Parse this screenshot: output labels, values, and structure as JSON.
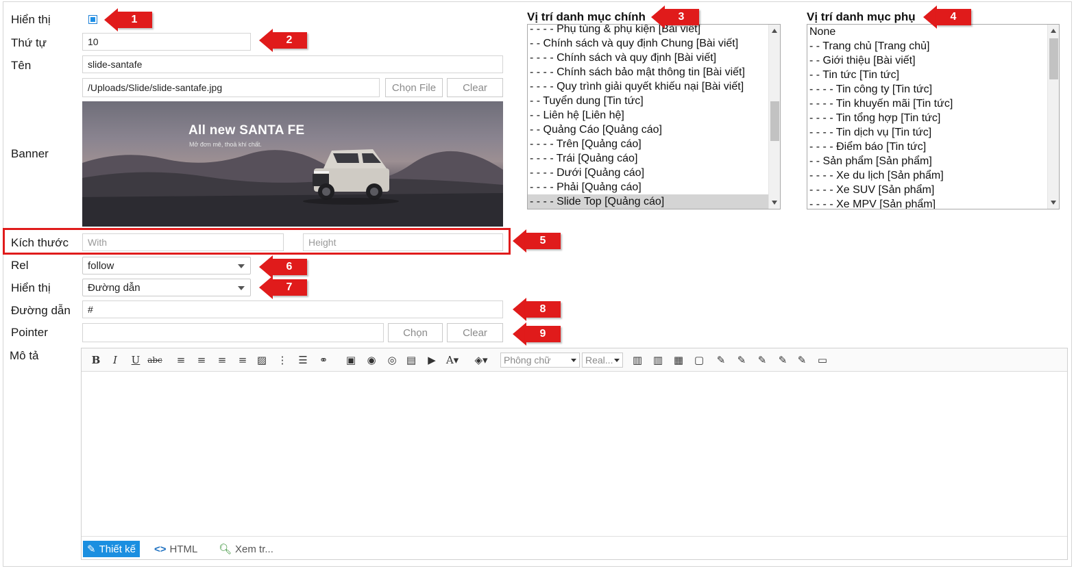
{
  "form": {
    "hien_thi_label": "Hiển thị",
    "thu_tu_label": "Thứ tự",
    "thu_tu_value": "10",
    "ten_label": "Tên",
    "ten_value": "slide-santafe",
    "file_path": "/Uploads/Slide/slide-santafe.jpg",
    "choose_file_label": "Chọn File",
    "clear_label": "Clear",
    "banner_label": "Banner",
    "banner_title": "All new SANTA FE",
    "banner_subtitle": "Mở đơn mê, thoả khí chất.",
    "kich_thuoc_label": "Kích thước",
    "width_placeholder": "With",
    "height_placeholder": "Height",
    "rel_label": "Rel",
    "rel_value": "follow",
    "hien_thi2_label": "Hiển thị",
    "hien_thi2_value": "Đường dẫn",
    "duong_dan_label": "Đường dẫn",
    "duong_dan_value": "#",
    "pointer_label": "Pointer",
    "pointer_choose_label": "Chọn",
    "pointer_clear_label": "Clear",
    "mo_ta_label": "Mô tả"
  },
  "badges": [
    "1",
    "2",
    "3",
    "4",
    "5",
    "6",
    "7",
    "8",
    "9"
  ],
  "main_category": {
    "title": "Vị trí danh mục chính",
    "items": [
      "- - - - Phụ tùng & phụ kiện [Bài viết]",
      "- - Chính sách và quy định Chung [Bài viết]",
      "- - - - Chính sách và quy định [Bài viết]",
      "- - - - Chính sách bảo mật thông tin [Bài viết]",
      "- - - - Quy trình giải quyết khiếu nại [Bài viết]",
      "- - Tuyển dung [Tin tức]",
      "- - Liên hệ [Liên hệ]",
      "- - Quảng Cáo [Quảng cáo]",
      "- - - - Trên [Quảng cáo]",
      "- - - - Trái [Quảng cáo]",
      "- - - - Dưới [Quảng cáo]",
      "- - - - Phải [Quảng cáo]",
      "- - - - Slide Top [Quảng cáo]"
    ],
    "selected_index": 12
  },
  "sub_category": {
    "title": "Vị trí danh mục phụ",
    "items": [
      "None",
      "- - Trang chủ [Trang chủ]",
      "- - Giới thiệu [Bài viết]",
      "- - Tin tức [Tin tức]",
      "- - - - Tin công ty [Tin tức]",
      "- - - - Tin khuyến mãi [Tin tức]",
      "- - - - Tin tổng hợp [Tin tức]",
      "- - - - Tin dịch vụ [Tin tức]",
      "- - - - Điểm báo [Tin tức]",
      "- - Sản phẩm [Sản phẩm]",
      "- - - - Xe du lịch [Sản phẩm]",
      "- - - - Xe SUV [Sản phẩm]",
      "- - - - Xe MPV [Sản phẩm]"
    ]
  },
  "editor": {
    "font_placeholder": "Phông chữ",
    "size_placeholder": "Real...",
    "mode_design": "Thiết kế",
    "mode_html": "HTML",
    "mode_preview": "Xem tr..."
  },
  "colors": {
    "accent": "#1b8fe0",
    "badge": "#e01b1b"
  }
}
